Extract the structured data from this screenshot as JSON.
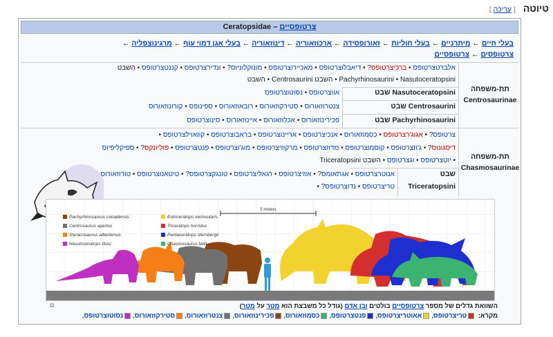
{
  "heading": {
    "title": "טיוטה",
    "edit_open": "[",
    "edit_label": "עריכה",
    "edit_close": "]"
  },
  "taxobox": {
    "header_en": "Ceratopsidae – ",
    "header_he": "צרטופסיים",
    "lineage": [
      {
        "text": "בעלי חיים",
        "link": true
      },
      {
        "text": "מיתרניים",
        "link": true
      },
      {
        "text": "בעלי חוליות",
        "link": true
      },
      {
        "text": "זאורופסידה",
        "link": true
      },
      {
        "text": "ארכוזאוריה",
        "link": true
      },
      {
        "text": "דינוזאוריה",
        "link": true
      },
      {
        "text": "בעלי אגן דמוי עוף",
        "link": true
      },
      {
        "text": "מרגינוצפליה",
        "link": true
      },
      {
        "text": "צרטופסים",
        "link": true
      },
      {
        "text": "צרטופסיים",
        "link": true
      }
    ],
    "arrow": "←",
    "subfamilies": [
      {
        "rank": "תת-משפחה",
        "name": "Centrosaurinae",
        "loose_lines": [
          [
            {
              "t": "אלברטצרטופס",
              "c": "link"
            },
            {
              "t": " • ",
              "c": "plain"
            },
            {
              "t": "ברכיצרטופס",
              "c": "red"
            },
            {
              "t": "? • ",
              "c": "plain"
            },
            {
              "t": "דיאבלוצרטופס",
              "c": "link"
            },
            {
              "t": " • ",
              "c": "plain"
            },
            {
              "t": "מאכיירוצרטופס",
              "c": "link"
            },
            {
              "t": " • ",
              "c": "plain"
            },
            {
              "t": "מונוקלוניוס",
              "c": "link"
            },
            {
              "t": "? • ",
              "c": "plain"
            },
            {
              "t": "ונדירצרטופס",
              "c": "link"
            },
            {
              "t": " • ",
              "c": "plain"
            },
            {
              "t": "קננטצרטופס",
              "c": "link"
            },
            {
              "t": " • הַשבט",
              "c": "plain"
            }
          ],
          [
            {
              "t": "Pachyrhinosaurini",
              "c": "plain"
            },
            {
              "t": " • ",
              "c": "plain"
            },
            {
              "t": "Nasutoceratopsini",
              "c": "plain"
            },
            {
              "t": " • השבט Centrosaurini",
              "c": "plain"
            },
            {
              "t": " • השבט",
              "c": "plain"
            }
          ]
        ],
        "tribes": [
          {
            "name": "Nasutoceratopsini שבט",
            "genera": [
              {
                "t": "אווצרטופס",
                "c": "link"
              },
              {
                "t": " • ",
                "c": "plain"
              },
              {
                "t": "נסוטוצרטופס",
                "c": "link"
              }
            ]
          },
          {
            "name": "Centrosaurini שבט",
            "genera": [
              {
                "t": "צנטרוזאורוס",
                "c": "link"
              },
              {
                "t": " • ",
                "c": "plain"
              },
              {
                "t": "סטירקוזאורוס",
                "c": "link"
              },
              {
                "t": " • ",
                "c": "plain"
              },
              {
                "t": "רובאוזאורוס",
                "c": "link"
              },
              {
                "t": " • ",
                "c": "plain"
              },
              {
                "t": "ספינופס",
                "c": "link"
              },
              {
                "t": " • ",
                "c": "plain"
              },
              {
                "t": "קורונוזאורוס",
                "c": "link"
              }
            ]
          },
          {
            "name": "Pachyrhinosaurini שבט",
            "genera": [
              {
                "t": "פכירינוזאורוס",
                "c": "link"
              },
              {
                "t": " • ",
                "c": "plain"
              },
              {
                "t": "אכלוזאורוס",
                "c": "link"
              },
              {
                "t": " • ",
                "c": "plain"
              },
              {
                "t": "איינוזאורוס",
                "c": "link"
              },
              {
                "t": " • ",
                "c": "plain"
              },
              {
                "t": "סינוצרטופס",
                "c": "link"
              }
            ]
          }
        ]
      },
      {
        "rank": "תת-משפחה",
        "name": "Chasmosaurinae",
        "loose_lines": [
          [
            {
              "t": "צרטופס",
              "c": "link"
            },
            {
              "t": "? • ",
              "c": "plain"
            },
            {
              "t": "אגוג'רצרטופס",
              "c": "red"
            },
            {
              "t": " • ",
              "c": "plain"
            },
            {
              "t": "כסמוזאורוס",
              "c": "link"
            },
            {
              "t": " • ",
              "c": "plain"
            },
            {
              "t": "אנכיצרטופס",
              "c": "link"
            },
            {
              "t": " • ",
              "c": "plain"
            },
            {
              "t": "אריינוצרטופס",
              "c": "link"
            },
            {
              "t": " • ",
              "c": "plain"
            },
            {
              "t": "בראבוצרטופס",
              "c": "link"
            },
            {
              "t": " • ",
              "c": "plain"
            },
            {
              "t": "קוואוילצרטופס",
              "c": "link"
            },
            {
              "t": " •",
              "c": "plain"
            }
          ],
          [
            {
              "t": "דיסגונוס",
              "c": "red"
            },
            {
              "t": "? • ",
              "c": "plain"
            },
            {
              "t": "ג'וזצרטופס",
              "c": "link"
            },
            {
              "t": " • ",
              "c": "plain"
            },
            {
              "t": "קוסמוצרטופס",
              "c": "link"
            },
            {
              "t": " • ",
              "c": "plain"
            },
            {
              "t": "מדוזצרטופס",
              "c": "link"
            },
            {
              "t": " • ",
              "c": "plain"
            },
            {
              "t": "מרקוזיצרטופס",
              "c": "link"
            },
            {
              "t": " • ",
              "c": "plain"
            },
            {
              "t": "מוג'וצרטופס",
              "c": "link"
            },
            {
              "t": " • ",
              "c": "plain"
            },
            {
              "t": "פנטצרטופס",
              "c": "link"
            },
            {
              "t": " • ",
              "c": "plain"
            },
            {
              "t": "פוליונקס",
              "c": "red"
            },
            {
              "t": "? • ",
              "c": "plain"
            },
            {
              "t": "ספיקליפיוס",
              "c": "link"
            }
          ],
          [
            {
              "t": "• ",
              "c": "plain"
            },
            {
              "t": "יוטצרטופס",
              "c": "link"
            },
            {
              "t": " • ",
              "c": "plain"
            },
            {
              "t": "וגצרטופס",
              "c": "link"
            },
            {
              "t": " • השבט Triceratopsini",
              "c": "plain"
            }
          ]
        ],
        "tribes": [
          {
            "name": "שבט",
            "genera": [
              {
                "t": "אנוטרצרטופס",
                "c": "link"
              },
              {
                "t": " • ",
                "c": "plain"
              },
              {
                "t": "אגתאומס",
                "c": "link"
              },
              {
                "t": "? • ",
                "c": "plain"
              },
              {
                "t": "אוזיצרטופס",
                "c": "link"
              },
              {
                "t": " • ",
                "c": "plain"
              },
              {
                "t": "רגאליצרטופס",
                "c": "link"
              },
              {
                "t": " • ",
                "c": "plain"
              },
              {
                "t": "טונגקצרטופס",
                "c": "link"
              },
              {
                "t": "? • ",
                "c": "plain"
              },
              {
                "t": "טיטאנוצרטופס",
                "c": "link"
              },
              {
                "t": " • ",
                "c": "plain"
              },
              {
                "t": "טורוזאורוס",
                "c": "link"
              }
            ]
          },
          {
            "name": "Triceratopsini",
            "genera": [
              {
                "t": "טריצרטופס",
                "c": "link"
              },
              {
                "t": " • ",
                "c": "plain"
              },
              {
                "t": "נדוצרטופס",
                "c": "link"
              },
              {
                "t": "? • ",
                "c": "plain"
              }
            ]
          }
        ]
      }
    ]
  },
  "figure": {
    "scale_label": "5 meters",
    "legend": [
      {
        "name": "Pachyrhinosaurus canadensis",
        "color": "#8B4513"
      },
      {
        "name": "Centrosaurus apertus",
        "color": "#707070"
      },
      {
        "name": "Styracosaurus albertensis",
        "color": "#F57F17"
      },
      {
        "name": "Nasutoceratops titusi",
        "color": "#C030C0"
      },
      {
        "name": "Eotriceratops xerinsularis",
        "color": "#F2D22E"
      },
      {
        "name": "Triceratops horridus",
        "color": "#D32F2F"
      },
      {
        "name": "Pentaceratops sternbergii",
        "color": "#1E2FD0"
      },
      {
        "name": "Chasmosaurus belli",
        "color": "#3CB371"
      }
    ],
    "human_color": "#2E9BD6"
  },
  "caption": {
    "text_a": "השוואת גדלים של מספר ",
    "link_a": "צרטופסיים",
    "text_b": " בולטים ",
    "link_b": "ובן אדם",
    "text_c": " (גודל כל משבצת הוא ",
    "link_c": "מטר",
    "text_d": " על ",
    "link_d": "מטר",
    "text_e": ")"
  },
  "key": {
    "label": "מקרא:",
    "items": [
      {
        "name": "טריצרטופס",
        "color": "#D32F2F"
      },
      {
        "name": "אאוטריצרטופס",
        "color": "#F2D22E"
      },
      {
        "name": "פנטצרטופס",
        "color": "#1E2FD0"
      },
      {
        "name": "כסמוזאורוס",
        "color": "#3CB371"
      },
      {
        "name": "פכירינוזאורוס",
        "color": "#8B4513"
      },
      {
        "name": "צנטרוזאורוס",
        "color": "#707070"
      },
      {
        "name": "סטירקוזאורוס",
        "color": "#F57F17"
      },
      {
        "name": "נסוטוצרטופס",
        "color": "#C030C0"
      }
    ]
  }
}
